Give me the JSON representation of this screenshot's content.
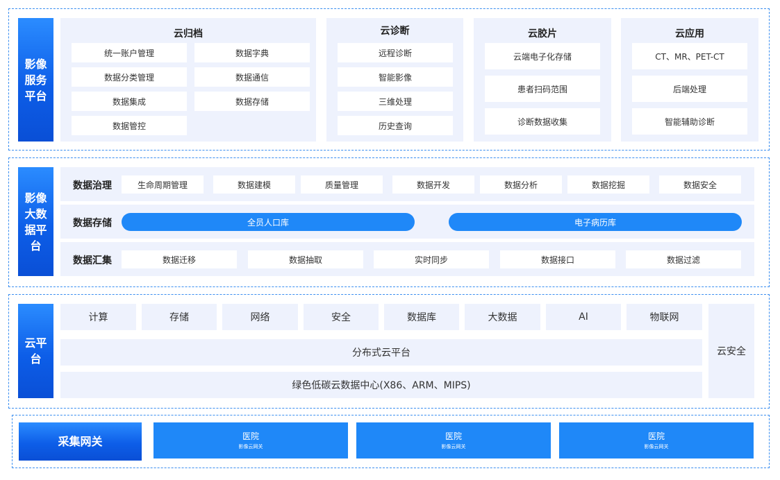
{
  "imaging_service": {
    "label": "影像\n服务\n平台",
    "archive": {
      "title": "云归档",
      "items": [
        "统一账户管理",
        "数据字典",
        "数据分类管理",
        "数据通信",
        "数据集成",
        "数据存储",
        "数据管控"
      ]
    },
    "diagnosis": {
      "title": "云诊断",
      "items": [
        "远程诊断",
        "智能影像",
        "三维处理",
        "历史查询"
      ]
    },
    "film": {
      "title": "云胶片",
      "items": [
        "云端电子化存储",
        "患者扫码范围",
        "诊断数据收集"
      ]
    },
    "application": {
      "title": "云应用",
      "items": [
        "CT、MR、PET-CT",
        "后端处理",
        "智能辅助诊断"
      ]
    }
  },
  "big_data": {
    "label": "影像\n大数\n据平\n台",
    "governance": {
      "title": "数据治理",
      "items": [
        "生命周期管理",
        "数据建模",
        "质量管理",
        "数据开发",
        "数据分析",
        "数据挖掘",
        "数据安全"
      ]
    },
    "storage": {
      "title": "数据存储",
      "items": [
        "全员人口库",
        "电子病历库"
      ]
    },
    "aggregation": {
      "title": "数据汇集",
      "items": [
        "数据迁移",
        "数据抽取",
        "实时同步",
        "数据接口",
        "数据过滤"
      ]
    }
  },
  "cloud_platform": {
    "label": "云平\n台",
    "services": [
      "计算",
      "存储",
      "网络",
      "安全",
      "数据库",
      "大数据",
      "AI",
      "物联网"
    ],
    "distributed": "分布式云平台",
    "datacenter": "绿色低碳云数据中心(X86、ARM、MIPS)",
    "security": "云安全"
  },
  "gateway": {
    "label": "采集网关",
    "hospitals": [
      {
        "name": "医院",
        "sub": "影像云网关"
      },
      {
        "name": "医院",
        "sub": "影像云网关"
      },
      {
        "name": "医院",
        "sub": "影像云网关"
      }
    ]
  }
}
